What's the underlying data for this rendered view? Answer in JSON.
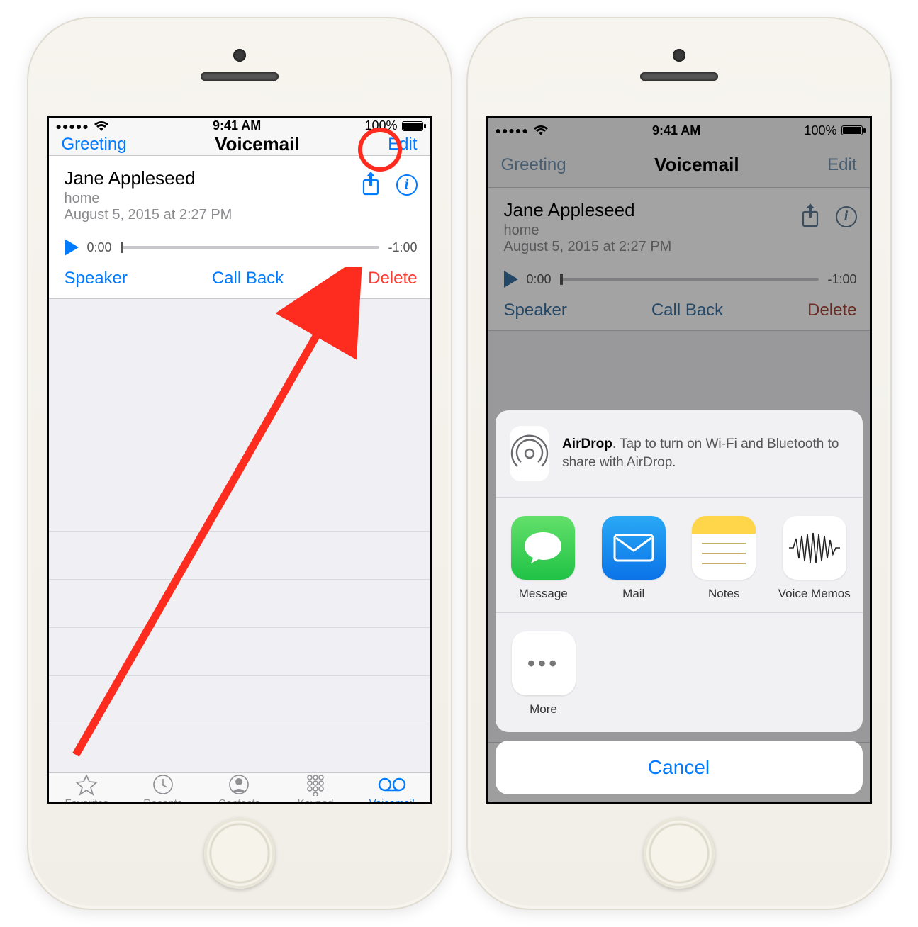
{
  "status": {
    "time": "9:41 AM",
    "battery": "100%",
    "signal": "●●●●●"
  },
  "nav": {
    "left": "Greeting",
    "title": "Voicemail",
    "right": "Edit"
  },
  "vm": {
    "name": "Jane Appleseed",
    "label": "home",
    "date": "August 5, 2015 at 2:27 PM",
    "elapsed": "0:00",
    "remaining": "-1:00",
    "speaker": "Speaker",
    "callback": "Call Back",
    "delete": "Delete"
  },
  "tabs": {
    "favorites": "Favorites",
    "recents": "Recents",
    "contacts": "Contacts",
    "keypad": "Keypad",
    "voicemail": "Voicemail"
  },
  "share": {
    "airdrop_bold": "AirDrop",
    "airdrop_rest": ". Tap to turn on Wi-Fi and Bluetooth to share with AirDrop.",
    "message": "Message",
    "mail": "Mail",
    "notes": "Notes",
    "voicememos": "Voice Memos",
    "more": "More",
    "cancel": "Cancel"
  }
}
